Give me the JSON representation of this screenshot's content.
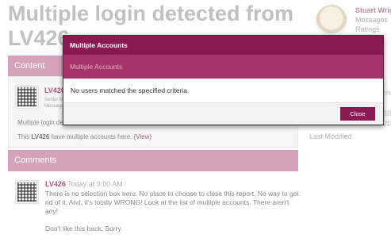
{
  "page": {
    "title": "Multiple login detected from LV426"
  },
  "right_column": {
    "user_name": "Stuart Wrigh",
    "line1": "Messages",
    "line2": "Ratings",
    "frag_bond": "ond",
    "frag_bb": "BB",
    "frag_vf": "VFo",
    "last_modified": "Last Modified"
  },
  "content": {
    "header": "Content",
    "item_user": "LV426",
    "item_sub1": "Senior M",
    "item_sub2": "Message",
    "detected_text": "Multiple login de",
    "accounts_prefix": "This ",
    "accounts_user": "LV426",
    "accounts_suffix": " have multiple accounts here. ",
    "view_link": "(View)"
  },
  "comments": {
    "header": "Comments",
    "user": "LV426",
    "time": " Today at 9:00 AM",
    "body_p1": "There is no selection box here. No place to choose to close this report. No way to get rid of it. And, it's totally WRONG! Look at the list of multiple accounts. There aren't any!",
    "body_p2": "Don't like this hack. Sorry."
  },
  "modal": {
    "title": "Multiple Accounts",
    "tab": "Multiple Accounts",
    "message": "No users matched the specified criteria.",
    "close_label": "Close"
  },
  "colors": {
    "modal_header": "#8b1a53",
    "modal_tab": "#a8336b",
    "section_bar": "#cf95b2",
    "close_button": "#8b1a53"
  }
}
